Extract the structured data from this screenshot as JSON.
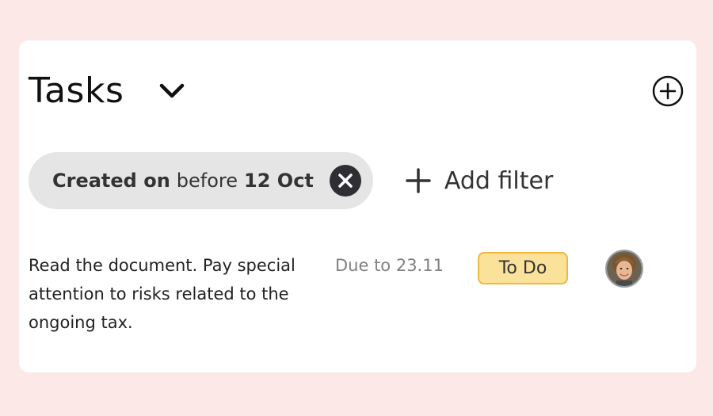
{
  "header": {
    "title": "Tasks",
    "dropdown_icon": "chevron-down-icon",
    "add_icon": "plus-circle-icon"
  },
  "filters": {
    "active_chip": {
      "field": "Created on",
      "operator": "before",
      "value": "12 Oct",
      "remove_icon": "close-circle-icon"
    },
    "add_filter_label": "Add filter",
    "add_filter_icon": "plus-icon"
  },
  "tasks": [
    {
      "description": "Read the document. Pay special attention to risks related to the ongoing tax.",
      "due": "Due to 23.11",
      "status": "To Do",
      "assignee_icon": "user-avatar"
    }
  ],
  "colors": {
    "page_background": "#fde8e8",
    "card_background": "#ffffff",
    "chip_background": "#e5e5e5",
    "status_todo_fill": "#fbe29a",
    "status_todo_border": "#f0b93a",
    "muted_text": "#808080"
  }
}
